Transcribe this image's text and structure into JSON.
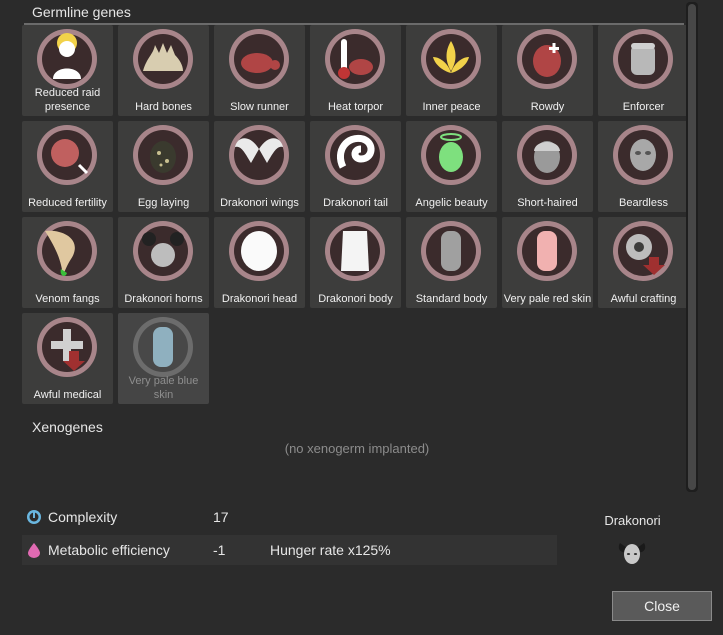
{
  "germline": {
    "title": "Germline genes",
    "genes": [
      {
        "label": "Reduced raid presence",
        "icon": "reduced-raid-presence-icon"
      },
      {
        "label": "Hard bones",
        "icon": "hard-bones-icon"
      },
      {
        "label": "Slow runner",
        "icon": "slow-runner-icon"
      },
      {
        "label": "Heat torpor",
        "icon": "heat-torpor-icon"
      },
      {
        "label": "Inner peace",
        "icon": "inner-peace-icon"
      },
      {
        "label": "Rowdy",
        "icon": "rowdy-icon"
      },
      {
        "label": "Enforcer",
        "icon": "enforcer-icon"
      },
      {
        "label": "Reduced fertility",
        "icon": "reduced-fertility-icon"
      },
      {
        "label": "Egg laying",
        "icon": "egg-laying-icon"
      },
      {
        "label": "Drakonori wings",
        "icon": "drakonori-wings-icon"
      },
      {
        "label": "Drakonori tail",
        "icon": "drakonori-tail-icon"
      },
      {
        "label": "Angelic beauty",
        "icon": "angelic-beauty-icon"
      },
      {
        "label": "Short-haired",
        "icon": "short-haired-icon"
      },
      {
        "label": "Beardless",
        "icon": "beardless-icon"
      },
      {
        "label": "Venom fangs",
        "icon": "venom-fangs-icon"
      },
      {
        "label": "Drakonori horns",
        "icon": "drakonori-horns-icon"
      },
      {
        "label": "Drakonori head",
        "icon": "drakonori-head-icon"
      },
      {
        "label": "Drakonori body",
        "icon": "drakonori-body-icon"
      },
      {
        "label": "Standard body",
        "icon": "standard-body-icon"
      },
      {
        "label": "Very pale red skin",
        "icon": "very-pale-red-skin-icon"
      },
      {
        "label": "Awful crafting",
        "icon": "awful-crafting-icon"
      },
      {
        "label": "Awful medical",
        "icon": "awful-medical-icon"
      },
      {
        "label": "Very pale blue skin",
        "icon": "very-pale-blue-skin-icon",
        "dimmed": true
      }
    ]
  },
  "xenogenes": {
    "title": "Xenogenes",
    "empty_text": "(no xenogerm implanted)"
  },
  "stats": {
    "complexity": {
      "label": "Complexity",
      "value": "17",
      "icon": "complexity-icon",
      "color": "#6ab7e0"
    },
    "metabolic": {
      "label": "Metabolic efficiency",
      "value": "-1",
      "extra": "Hunger rate x125%",
      "icon": "metabolic-icon",
      "color": "#e06ab2"
    }
  },
  "xenotype": {
    "name": "Drakonori",
    "icon": "drakonori-xenotype-icon"
  },
  "close_label": "Close",
  "colors": {
    "background": "#2b2b2b",
    "tile": "#3d3d3c",
    "gene_ring": "#a8858a",
    "gene_disc": "#e8a8ac",
    "text": "#dcdcdc"
  }
}
